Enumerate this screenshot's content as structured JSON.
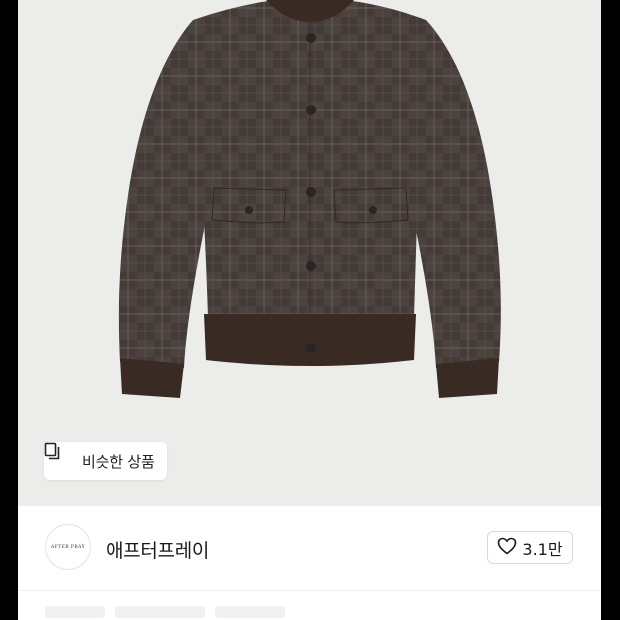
{
  "product": {
    "image_alt": "Brown glen check wool bomber jacket",
    "similar_button_label": "비슷한 상품"
  },
  "shop": {
    "avatar_text": "AFTER PRAY",
    "name": "애프터프레이",
    "like_count": "3.1만"
  },
  "icons": {
    "similar": "similar-products-icon",
    "like": "heart-outline-icon"
  },
  "colors": {
    "image_bg": "#ececeb",
    "jacket_main": "#4a423f",
    "rib_knit": "#3a2a24"
  }
}
